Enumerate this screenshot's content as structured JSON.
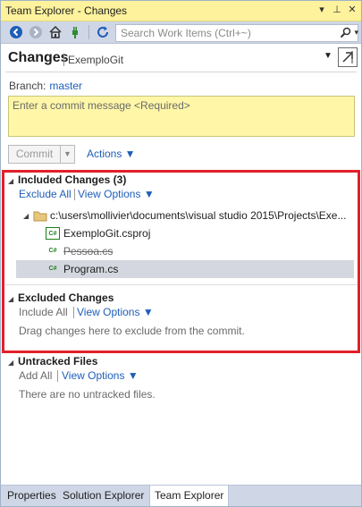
{
  "window": {
    "title": "Team Explorer - Changes",
    "controls": {
      "dropdown": "▾",
      "pin": "⊥",
      "close": "✕"
    }
  },
  "toolbar": {
    "search_placeholder": "Search Work Items (Ctrl+~)",
    "search_icon": "search-icon",
    "search_dropdown": "▾"
  },
  "header": {
    "title": "Changes",
    "subtitle": "ExemploGit",
    "dropdown": "▼"
  },
  "branch": {
    "label": "Branch:",
    "value": "master"
  },
  "commit": {
    "message_placeholder": "Enter a commit message <Required>",
    "button_label": "Commit",
    "dropdown": "▼",
    "actions_label": "Actions ▼"
  },
  "included": {
    "title": "Included Changes (3)",
    "exclude_all": "Exclude All",
    "view_options": "View Options ▼",
    "folder_path": "c:\\users\\mollivier\\documents\\visual studio 2015\\Projects\\Exe...",
    "files": [
      {
        "name": "ExemploGit.csproj",
        "icon": "C#",
        "deleted": false,
        "selected": false
      },
      {
        "name": "Pessoa.cs",
        "icon": "C#",
        "deleted": true,
        "selected": false
      },
      {
        "name": "Program.cs",
        "icon": "C#",
        "deleted": false,
        "selected": true
      }
    ]
  },
  "excluded": {
    "title": "Excluded Changes",
    "include_all": "Include All",
    "view_options": "View Options ▼",
    "note": "Drag changes here to exclude from the commit."
  },
  "untracked": {
    "title": "Untracked Files",
    "add_all": "Add All",
    "view_options": "View Options ▼",
    "note": "There are no untracked files."
  },
  "bottom_tabs": [
    "Properties",
    "Solution Explorer",
    "Team Explorer"
  ],
  "colors": {
    "title_bar": "#fff29d",
    "toolbar": "#cfd6e5",
    "link": "#1e5eb8",
    "highlight_box": "#e2202b",
    "commit_box": "#fff6a8"
  }
}
